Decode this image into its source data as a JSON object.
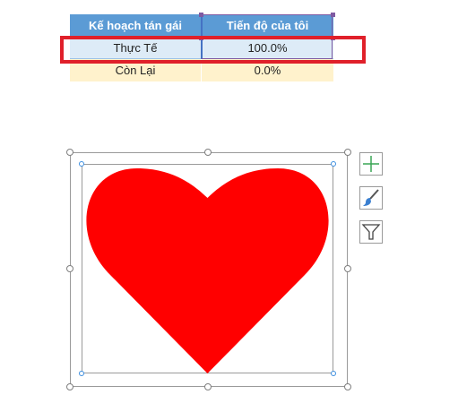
{
  "table": {
    "header": {
      "col1": "Kế hoạch tán gái",
      "col2": "Tiến độ của tôi"
    },
    "rows": [
      {
        "label": "Thực Tế",
        "value": "100.0%"
      },
      {
        "label": "Còn Lại",
        "value": "0.0%"
      }
    ]
  },
  "chart": {
    "shape_icon": "heart",
    "fill_color": "#ff0000",
    "progress_fraction": 1.0
  },
  "tools": {
    "chart_elements_icon": "plus-icon",
    "chart_styles_icon": "paintbrush-icon",
    "chart_filters_icon": "funnel-icon"
  },
  "colors": {
    "header_bg": "#5b9bd5",
    "actual_row_bg": "#ddebf7",
    "remaining_row_bg": "#fff2cc",
    "highlight_border": "#e0202a",
    "heart_fill": "#ff0000"
  }
}
